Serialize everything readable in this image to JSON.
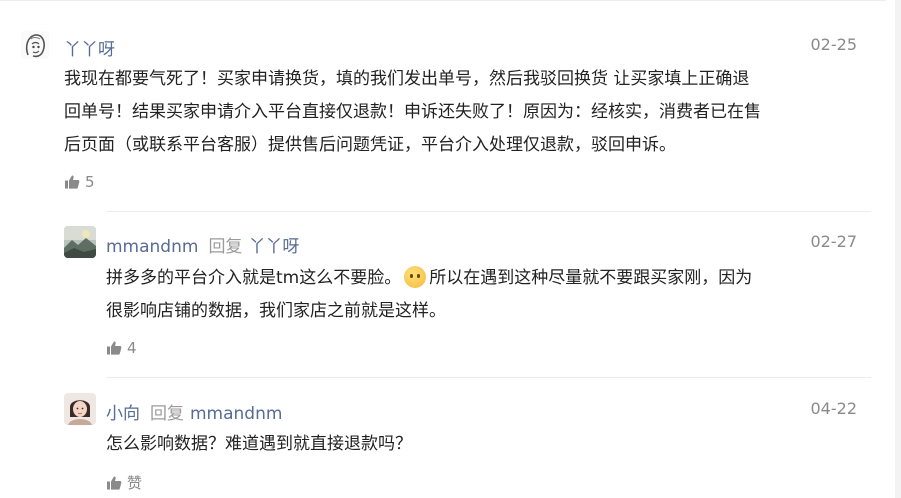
{
  "comments": [
    {
      "author": "丫丫呀",
      "date": "02-25",
      "lines": [
        "我现在都要气死了！买家申请换货，填的我们发出单号，然后我驳回换货 让买家填上正确退",
        "回单号！结果买家申请介入平台直接仅退款！申诉还失败了！原因为：经核实，消费者已在售",
        "后页面（或联系平台客服）提供售后问题凭证，平台介入处理仅退款，驳回申诉。"
      ],
      "likes": "5"
    },
    {
      "author": "mmandnm",
      "reply_word": "回复",
      "reply_to": "丫丫呀",
      "date": "02-27",
      "line1_a": "拼多多的平台介入就是tm这么不要脸。",
      "line1_b": "所以在遇到这种尽量就不要跟买家刚，因为",
      "line2": "很影响店铺的数据，我们家店之前就是这样。",
      "emoji": "smile-emoji",
      "likes": "4"
    },
    {
      "author": "小向",
      "reply_word": "回复",
      "reply_to": "mmandnm",
      "date": "04-22",
      "lines": [
        "怎么影响数据？难道遇到就直接退款吗？"
      ],
      "likes": "赞"
    }
  ],
  "colors": {
    "author": "#576b95",
    "meta": "#8a8a8a",
    "text": "#222222",
    "divider": "#ececec"
  }
}
